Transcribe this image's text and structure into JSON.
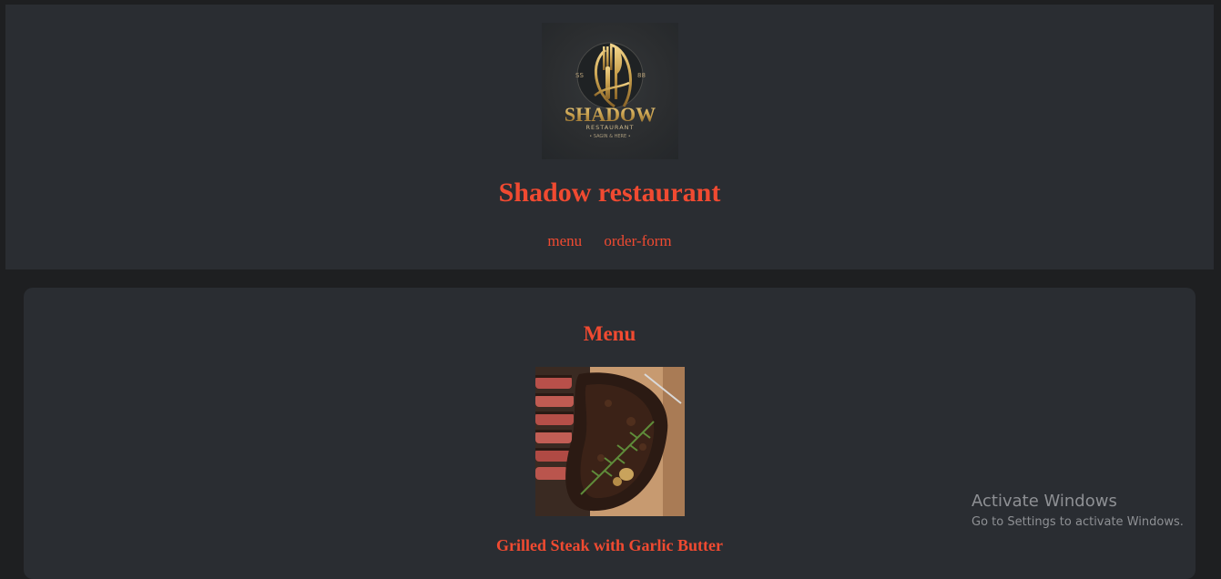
{
  "header": {
    "logo": {
      "alt": "Shadow restaurant logo",
      "wordmark": "SHADOW",
      "subtitle": "RESTAURANT",
      "tagline": "• SAGIN & HERE •",
      "left_mark": "SS",
      "right_mark": "88"
    },
    "site_title": "Shadow restaurant",
    "nav": [
      {
        "label": "menu"
      },
      {
        "label": "order-form"
      }
    ]
  },
  "main": {
    "section_title": "Menu",
    "items": [
      {
        "image_alt": "Grilled steak",
        "name": "Grilled Steak with Garlic Butter"
      }
    ]
  },
  "watermark": {
    "title": "Activate Windows",
    "subtitle": "Go to Settings to activate Windows."
  },
  "colors": {
    "background": "#1e1f21",
    "panel": "#2a2d32",
    "accent": "#f04a31",
    "gold": "#c9a14e"
  }
}
